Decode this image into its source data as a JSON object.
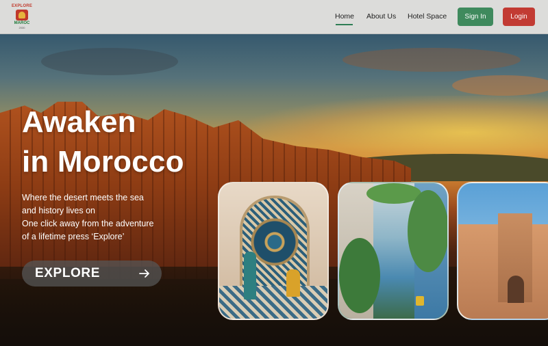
{
  "brand": {
    "logo_top": "EXPLORE",
    "logo_bottom": "MAROC",
    "logo_year": "2030"
  },
  "nav": {
    "items": [
      {
        "label": "Home",
        "active": true
      },
      {
        "label": "About Us",
        "active": false
      },
      {
        "label": "Hotel Space",
        "active": false
      }
    ],
    "signin_label": "Sign In",
    "login_label": "Login"
  },
  "hero": {
    "title_line1": "Awaken",
    "title_line2": "in Morocco",
    "subtitle_lines": [
      "Where the desert meets the sea",
      "and history lives on",
      "One click away from the adventure",
      "of a lifetime press ‘Explore’"
    ],
    "cta_label": "EXPLORE",
    "cta_icon": "arrow-right-icon"
  },
  "colors": {
    "accent_green": "#3f8a5d",
    "accent_red": "#c23b33",
    "nav_bg": "#dcdcda"
  }
}
